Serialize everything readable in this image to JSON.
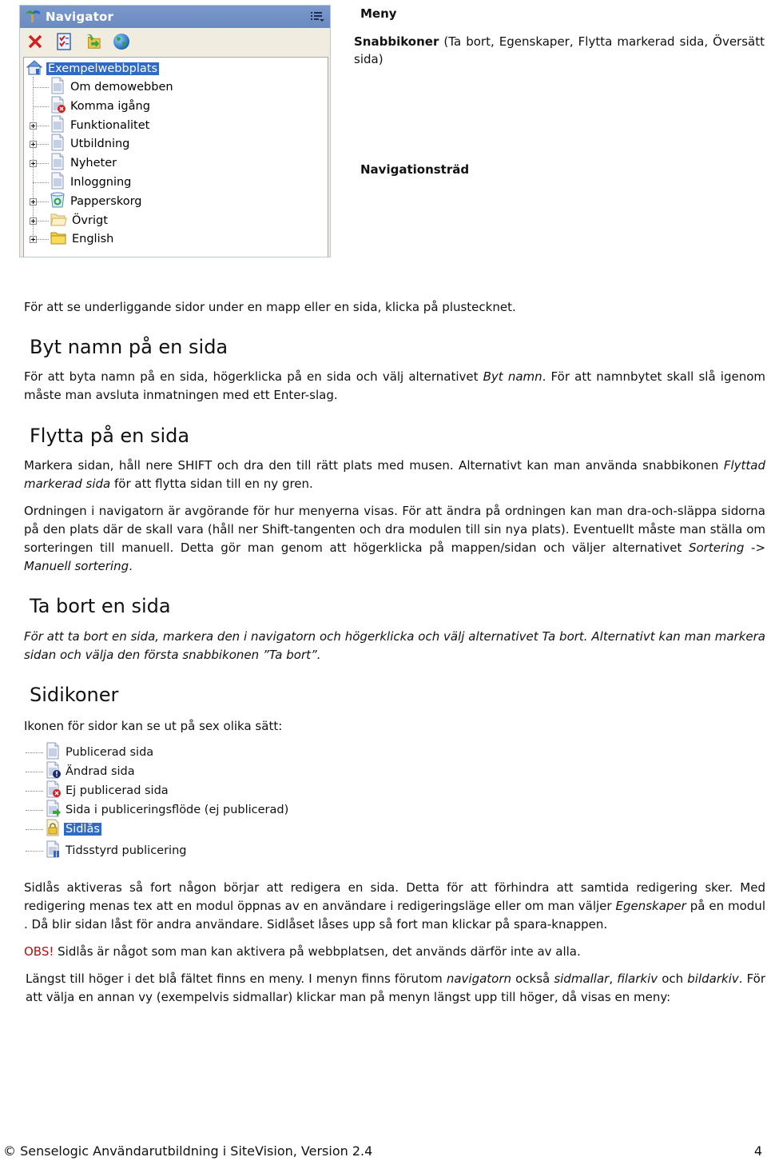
{
  "navigator": {
    "title": "Navigator",
    "menu_icon": "list-menu-icon",
    "toolbar": [
      {
        "name": "delete",
        "icon": "red-x-icon"
      },
      {
        "name": "properties",
        "icon": "checklist-icon"
      },
      {
        "name": "move-selected-page",
        "icon": "move-folder-icon"
      },
      {
        "name": "translate-page",
        "icon": "globe-icon"
      }
    ],
    "root": {
      "label": "Exempelwebbplats",
      "icon": "home-icon",
      "selected": true
    },
    "items": [
      {
        "label": "Om demowebben",
        "icon": "page-icon",
        "expandable": false
      },
      {
        "label": "Komma igång",
        "icon": "page-unpublished-icon",
        "expandable": false
      },
      {
        "label": "Funktionalitet",
        "icon": "page-icon",
        "expandable": true
      },
      {
        "label": "Utbildning",
        "icon": "page-icon",
        "expandable": true
      },
      {
        "label": "Nyheter",
        "icon": "page-icon",
        "expandable": true
      },
      {
        "label": "Inloggning",
        "icon": "page-icon",
        "expandable": false
      },
      {
        "label": "Papperskorg",
        "icon": "recycle-bin-icon",
        "expandable": true
      },
      {
        "label": "Övrigt",
        "icon": "folder-open-icon",
        "expandable": true
      },
      {
        "label": "English",
        "icon": "folder-icon",
        "expandable": true
      }
    ]
  },
  "annotations": {
    "menu": "Meny",
    "shortcuts_bold": "Snabbikoner",
    "shortcuts_rest": "(Ta bort, Egenskaper, Flytta markerad sida, Översätt sida)",
    "tree": "Navigationsträd"
  },
  "intro": "För att se underliggande sidor under en mapp eller en sida, klicka på plustecknet.",
  "sections": {
    "rename": {
      "heading": "Byt namn på en sida",
      "p1_a": "För att byta namn på en sida, högerklicka på en sida och välj alternativet ",
      "p1_em": "Byt namn",
      "p1_b": ". För att namnbytet skall slå igenom måste man avsluta inmatningen med ett Enter-slag."
    },
    "move": {
      "heading": "Flytta på en sida",
      "p1_a": "Markera sidan, håll nere SHIFT och dra den till rätt plats med musen. Alternativt kan man använda snabbikonen ",
      "p1_em": "Flyttad markerad sida",
      "p1_b": " för att flytta sidan till en ny gren.",
      "p2_a": "Ordningen i navigatorn är avgörande för hur menyerna visas. För att ändra på ordningen kan man dra-och-släppa sidorna på den plats där de skall vara (håll ner Shift-tangenten och dra modulen till sin nya plats). Eventuellt måste man ställa om sorteringen till manuell. Detta gör man genom att högerklicka på mappen/sidan och väljer alternativet ",
      "p2_em1": "Sortering",
      "p2_mid": " -> ",
      "p2_em2": "Manuell sortering",
      "p2_b": "."
    },
    "delete": {
      "heading": "Ta bort en sida",
      "p1": "För  att ta bort en sida, markera den i navigatorn och högerklicka och välj alternativet Ta bort.  Alternativt kan man markera sidan och välja den första snabbikonen ”Ta bort”."
    },
    "icons": {
      "heading": "Sidikoner",
      "intro": "Ikonen för sidor kan se ut på sex olika sätt:",
      "list": [
        {
          "label": "Publicerad sida",
          "icon": "page-icon",
          "selected": false
        },
        {
          "label": "Ändrad sida",
          "icon": "page-changed-icon",
          "selected": false
        },
        {
          "label": "Ej publicerad sida",
          "icon": "page-unpublished-icon",
          "selected": false
        },
        {
          "label": "Sida i publiceringsflöde (ej publicerad)",
          "icon": "page-workflow-icon",
          "selected": false
        },
        {
          "label": "Sidlås",
          "icon": "page-lock-icon",
          "selected": true
        },
        {
          "label": "Tidsstyrd publicering",
          "icon": "page-scheduled-icon",
          "selected": false
        }
      ]
    },
    "lock": {
      "p1_a": "Sidlås aktiveras så fort någon börjar att redigera en sida. Detta för att förhindra att samtida redigering sker. Med redigering menas tex att en modul öppnas av en användare i redigeringsläge eller om man väljer ",
      "p1_em": "Egenskaper",
      "p1_b": " på en modul . Då blir sidan låst för andra användare. Sidlåset låses upp så fort man klickar på spara-knappen.",
      "obs_label": "OBS!",
      "obs_text": " Sidlås är något som man kan aktivera på webbplatsen, det används därför inte av alla."
    },
    "menu": {
      "p1_a": "Längst till höger i det blå fältet finns en meny. I menyn finns förutom ",
      "p1_em1": "navigatorn",
      "p1_b": " också ",
      "p1_em2": "sidmallar",
      "p1_c": ", ",
      "p1_em3": "filarkiv",
      "p1_d": " och ",
      "p1_em4": "bildarkiv",
      "p1_e": ". För att välja en annan vy (exempelvis sidmallar) klickar man på menyn längst upp till höger, då visas en meny:"
    }
  },
  "footer": {
    "text": "© Senselogic Användarutbildning i SiteVision, Version 2.4",
    "page_number": "4"
  },
  "colors": {
    "nav_header": "#6b8ac0",
    "selection": "#316ac5",
    "toolbar_bg": "#f0ede0",
    "obs": "#b01010"
  }
}
